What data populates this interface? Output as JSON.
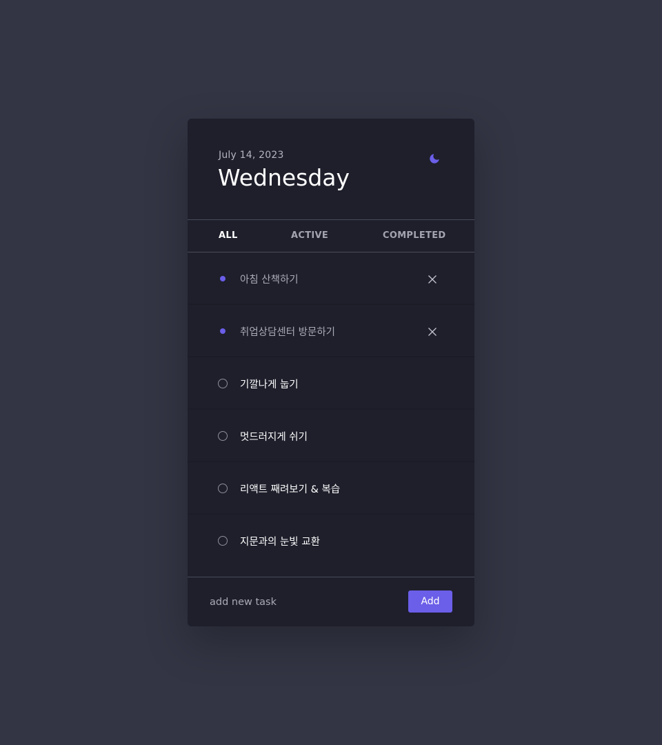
{
  "header": {
    "date": "July 14, 2023",
    "day": "Wednesday",
    "theme_icon": "moon-icon",
    "accent_color": "#6b5ee8"
  },
  "tabs": [
    {
      "label": "ALL",
      "active": true
    },
    {
      "label": "ACTIVE",
      "active": false
    },
    {
      "label": "COMPLETED",
      "active": false
    }
  ],
  "tasks": [
    {
      "label": "아침 산책하기",
      "completed": true
    },
    {
      "label": "취업상담센터 방문하기",
      "completed": true
    },
    {
      "label": "기깔나게 눕기",
      "completed": false
    },
    {
      "label": "멋드러지게 쉬기",
      "completed": false
    },
    {
      "label": "리액트 째려보기 & 복습",
      "completed": false
    },
    {
      "label": "지문과의 눈빛 교환",
      "completed": false
    }
  ],
  "footer": {
    "input_value": "",
    "input_placeholder": "add new task",
    "add_label": "Add"
  }
}
